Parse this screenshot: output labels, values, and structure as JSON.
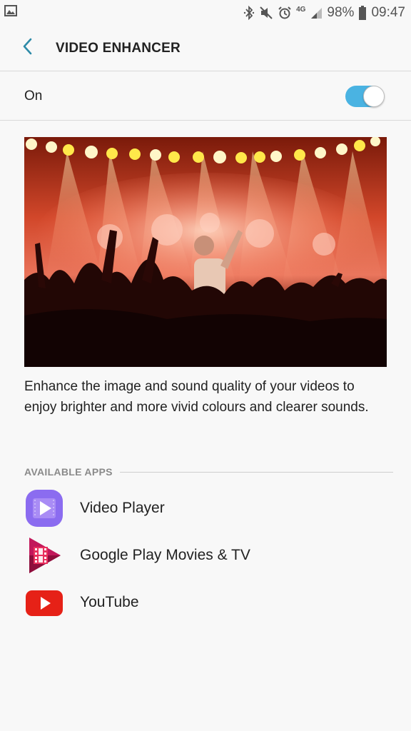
{
  "status_bar": {
    "network": "4G",
    "battery": "98%",
    "time": "09:47",
    "icons": [
      "gallery-icon",
      "bluetooth-icon",
      "mute-icon",
      "alarm-icon",
      "signal-icon",
      "battery-icon"
    ]
  },
  "header": {
    "title": "VIDEO ENHANCER",
    "back_icon": "chevron-left-icon",
    "accent_color": "#2e8ba8"
  },
  "toggle": {
    "label": "On",
    "state": true,
    "color": "#4ab3e2"
  },
  "description": "Enhance the image and sound quality of your videos to enjoy brighter and more vivid colours and clearer sounds.",
  "apps_section": {
    "title": "AVAILABLE APPS",
    "apps": [
      {
        "name": "Video Player",
        "icon": "video-player-icon",
        "color": "#8b6cf0"
      },
      {
        "name": "Google Play Movies & TV",
        "icon": "play-movies-icon",
        "color": "#c2185b"
      },
      {
        "name": "YouTube",
        "icon": "youtube-icon",
        "color": "#e62117"
      }
    ]
  }
}
